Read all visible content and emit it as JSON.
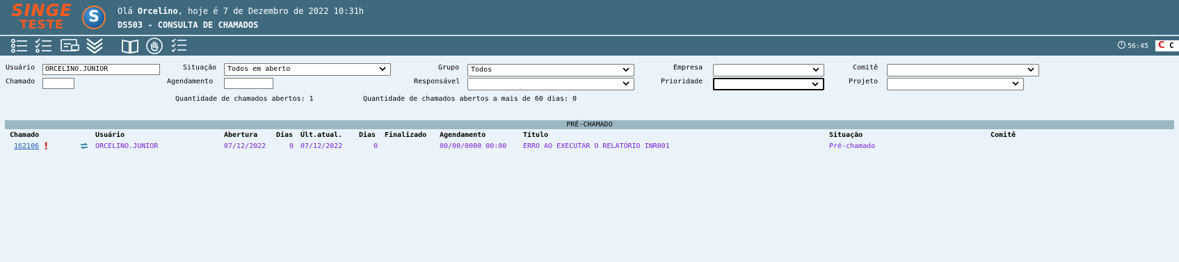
{
  "header": {
    "logo_top": "SINGE",
    "logo_bottom": "TESTE",
    "logo_mark": "S",
    "greeting_prefix": "Olá",
    "user_name": "Orcelino",
    "greeting_suffix": ", hoje é 7 de Dezembro de 2022 10:31h",
    "screen_title": "DS503 - CONSULTA DE CHAMADOS"
  },
  "toolbar": {
    "icons": [
      "list-icon",
      "checklist-icon",
      "card-icon",
      "double-chevron-down-icon",
      "book-icon",
      "hand-stop-icon",
      "task-list-icon"
    ],
    "session_timer": "56:45",
    "close_label": "C"
  },
  "filters": {
    "usuario_label": "Usuário",
    "usuario_value": "ORCELINO.JUNIOR",
    "chamado_label": "Chamado",
    "chamado_value": "",
    "situacao_label": "Situação",
    "situacao_value": "Todos em aberto",
    "agendamento_label": "Agendamento",
    "agendamento_value": "",
    "grupo_label": "Grupo",
    "grupo_value": "Todos",
    "responsavel_label": "Responsável",
    "responsavel_value": "",
    "empresa_label": "Empresa",
    "empresa_value": "",
    "prioridade_label": "Prioridade",
    "prioridade_value": "",
    "comite_label": "Comitê",
    "comite_value": "",
    "projeto_label": "Projeto",
    "projeto_value": "",
    "qtd_abertos": "Quantidade de chamados abertos: 1",
    "qtd_60_dias": "Quantidade de chamados abertos a mais de 60 dias: 0"
  },
  "table": {
    "section_title": "PRÉ-CHAMADO",
    "headers": {
      "chamado": "Chamado",
      "usuario": "Usuário",
      "abertura": "Abertura",
      "dias1": "Dias",
      "ult_atual": "Últ.atual.",
      "dias2": "Dias",
      "finalizado": "Finalizado",
      "agendamento": "Agendamento",
      "titulo": "Título",
      "situacao": "Situação",
      "comite": "Comitê"
    },
    "rows": [
      {
        "chamado": "162106",
        "priority_mark": "!",
        "usuario": "ORCELINO.JUNIOR",
        "abertura": "07/12/2022",
        "dias1": "0",
        "ult_atual": "07/12/2022",
        "dias2": "0",
        "finalizado": "",
        "agendamento": "00/00/0000 00:00",
        "titulo": "ERRO AO EXECUTAR O RELATÓRIO INR001",
        "situacao": "Pré-chamado",
        "comite": ""
      }
    ]
  },
  "colors": {
    "header_bg": "#3f6a7e",
    "page_bg": "#eaf3fa",
    "band_bg": "#9bb7c2",
    "row_text": "#7a1fd6",
    "link": "#1b55b5",
    "alert": "#e21b1b",
    "logo": "#ff5a1f"
  }
}
